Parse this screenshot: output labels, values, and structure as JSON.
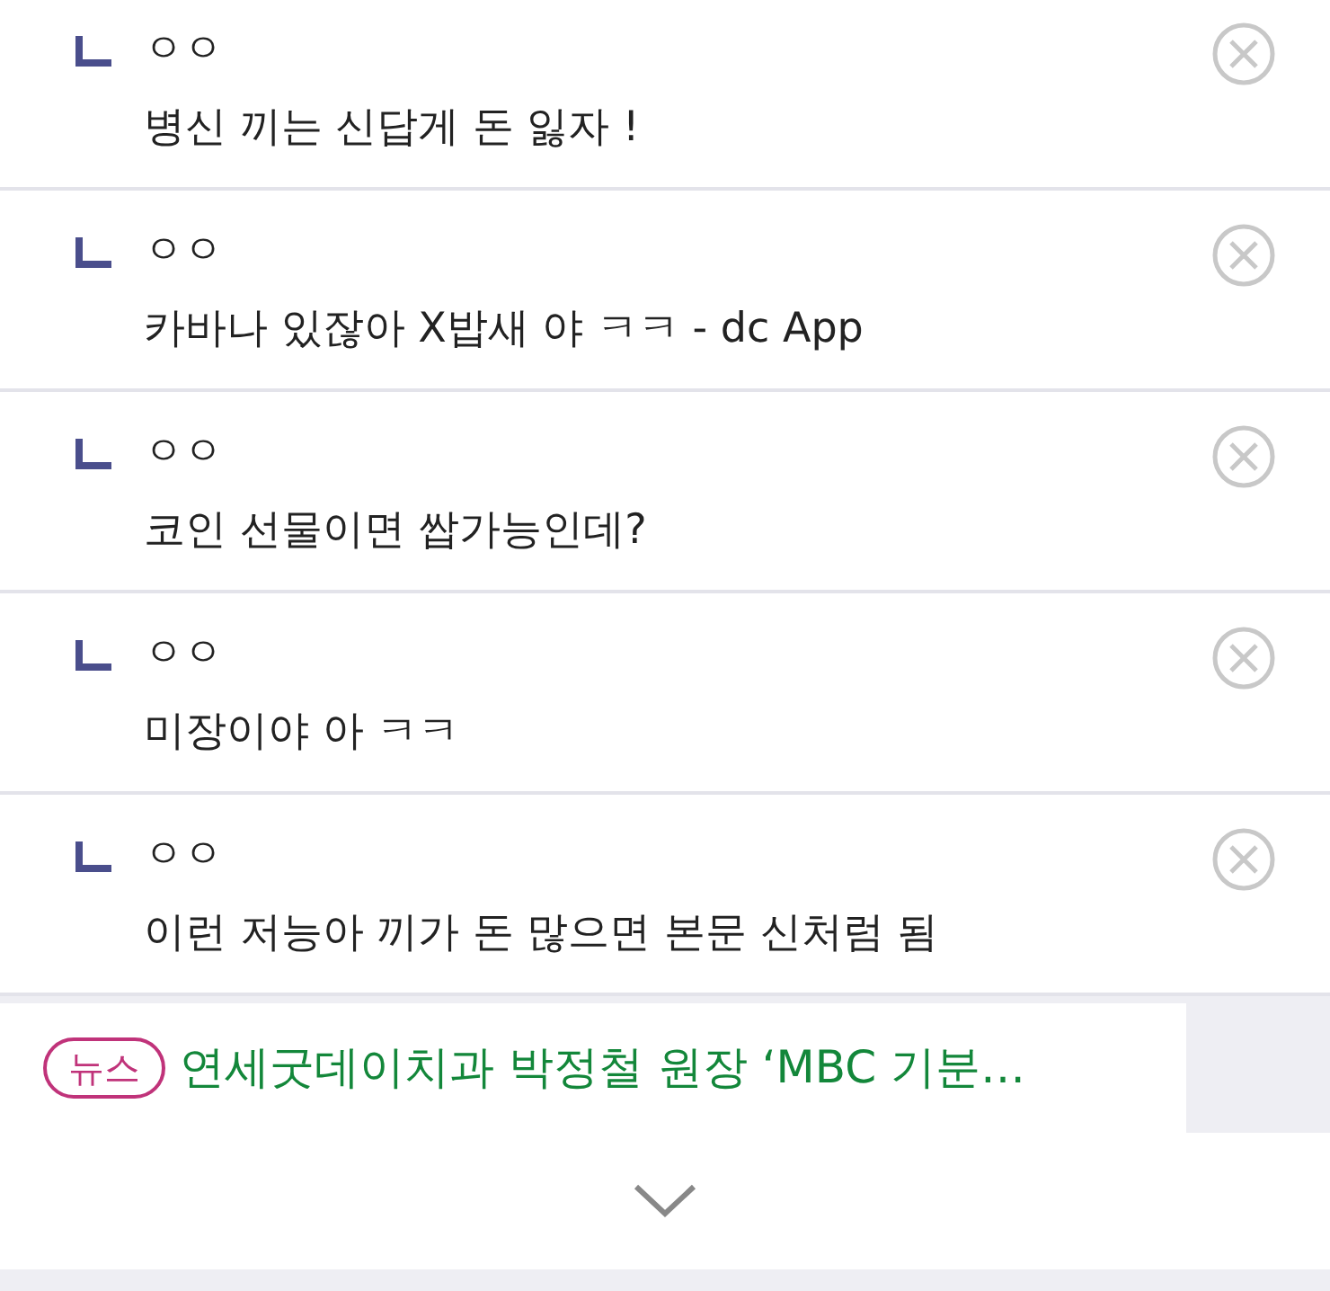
{
  "comments": [
    {
      "author": "ㅇㅇ",
      "text": "병신 끼는 신답게 돈 잃자 !"
    },
    {
      "author": "ㅇㅇ",
      "text": "카바나 있잖아 X밥새 야 ㅋㅋ - dc App"
    },
    {
      "author": "ㅇㅇ",
      "text": "코인 선물이면 쌉가능인데?"
    },
    {
      "author": "ㅇㅇ",
      "text": "미장이야 아 ㅋㅋ"
    },
    {
      "author": "ㅇㅇ",
      "text": "이런 저능아 끼가 돈 많으면 본문 신처럼 됨"
    }
  ],
  "news": {
    "badge": "뉴스",
    "headline": "연세굿데이치과 박정철 원장 ‘MBC 기분…"
  }
}
